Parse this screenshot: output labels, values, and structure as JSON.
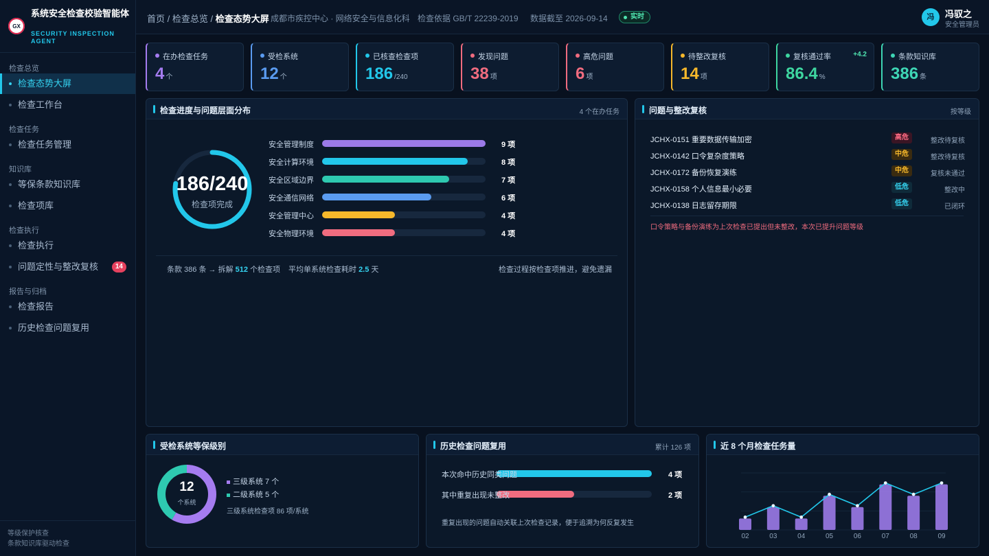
{
  "brand": {
    "logo_text": "GX",
    "title": "系统安全检查校验智能体",
    "subtitle": "SECURITY INSPECTION AGENT"
  },
  "sidebar": {
    "groups": [
      {
        "label": "检查总览",
        "items": [
          {
            "label": "检查态势大屏",
            "active": true
          },
          {
            "label": "检查工作台"
          }
        ]
      },
      {
        "label": "检查任务",
        "items": [
          {
            "label": "检查任务管理"
          }
        ]
      },
      {
        "label": "知识库",
        "items": [
          {
            "label": "等保条款知识库"
          },
          {
            "label": "检查项库"
          }
        ]
      },
      {
        "label": "检查执行",
        "items": [
          {
            "label": "检查执行"
          },
          {
            "label": "问题定性与整改复核",
            "badge": "14"
          }
        ]
      },
      {
        "label": "报告与归档",
        "items": [
          {
            "label": "检查报告"
          },
          {
            "label": "历史检查问题复用"
          }
        ]
      }
    ],
    "footer": [
      "等级保护核查",
      "条款知识库驱动检查"
    ]
  },
  "header": {
    "breadcrumb_home": "首页",
    "breadcrumb_mid": "检查总览",
    "breadcrumb_current": "检查态势大屏",
    "org": "成都市疾控中心 · 网络安全与信息化科",
    "basis": "检查依据 GB/T 22239-2019",
    "data_date": "数据截至 2026-09-14",
    "live": "实时",
    "user_initial": "冯",
    "user_name": "冯驭之",
    "user_role": "安全管理员"
  },
  "kpis": [
    {
      "label": "在办检查任务",
      "value": "4",
      "unit": "个",
      "color": "#a57cf0"
    },
    {
      "label": "受检系统",
      "value": "12",
      "unit": "个",
      "color": "#5a9bf0"
    },
    {
      "label": "已核查检查项",
      "value": "186",
      "unit": "/240",
      "color": "#22c7ea"
    },
    {
      "label": "发现问题",
      "value": "38",
      "unit": "项",
      "color": "#f06c7f"
    },
    {
      "label": "高危问题",
      "value": "6",
      "unit": "项",
      "color": "#f06c7f"
    },
    {
      "label": "待整改复核",
      "value": "14",
      "unit": "项",
      "color": "#f6b82b"
    },
    {
      "label": "复核通过率",
      "value": "86.4",
      "unit": "%",
      "color": "#3ed6a0",
      "delta": "+4.2"
    },
    {
      "label": "条款知识库",
      "value": "386",
      "unit": "条",
      "color": "#3ed6b5"
    }
  ],
  "progress_panel": {
    "title": "检查进度与问题层面分布",
    "extra": "4 个在办任务",
    "ring_value": "186/240",
    "ring_label": "检查项完成",
    "ring_done": 186,
    "ring_total": 240,
    "layers": [
      {
        "name": "安全管理制度",
        "value": 9,
        "label": "9 项",
        "color": "#9b7ae8"
      },
      {
        "name": "安全计算环境",
        "value": 8,
        "label": "8 项",
        "color": "#22c7ea"
      },
      {
        "name": "安全区域边界",
        "value": 7,
        "label": "7 项",
        "color": "#2ec9b0"
      },
      {
        "name": "安全通信网络",
        "value": 6,
        "label": "6 项",
        "color": "#5a9bf0"
      },
      {
        "name": "安全管理中心",
        "value": 4,
        "label": "4 项",
        "color": "#f6b82b"
      },
      {
        "name": "安全物理环境",
        "value": 4,
        "label": "4 项",
        "color": "#f06c7f"
      }
    ],
    "layer_max": 9,
    "foot_a1": "条款 386 条 → 拆解",
    "foot_a2": "512",
    "foot_a3": "个检查项",
    "foot_b1": "平均单系统检查耗时",
    "foot_b2": "2.5",
    "foot_b3": "天",
    "foot_c": "检查过程按检查项推进，避免遗漏"
  },
  "issues_panel": {
    "title": "问题与整改复核",
    "extra": "按等级",
    "rows": [
      {
        "name": "JCHX-0151 重要数据传输加密",
        "level": "高危",
        "status": "整改待复核"
      },
      {
        "name": "JCHX-0142 口令复杂度策略",
        "level": "中危",
        "status": "整改待复核"
      },
      {
        "name": "JCHX-0172 备份恢复演练",
        "level": "中危",
        "status": "复核未通过"
      },
      {
        "name": "JCHX-0158 个人信息最小必要",
        "level": "低危",
        "status": "整改中"
      },
      {
        "name": "JCHX-0138 日志留存期限",
        "level": "低危",
        "status": "已闭环"
      }
    ],
    "note": "口令策略与备份演练为上次检查已提出但未整改，本次已提升问题等级",
    "level_colors": {
      "高危": {
        "bg": "#3a1524",
        "fg": "#ff6b84"
      },
      "中危": {
        "bg": "#3a2b10",
        "fg": "#f6b82b"
      },
      "低危": {
        "bg": "#0f2b3a",
        "fg": "#35d3f1"
      }
    },
    "status_closed_color": "#8ea2b8"
  },
  "level_panel": {
    "title": "受检系统等保级别",
    "total": "12",
    "total_label": "个系统",
    "legend": [
      {
        "label": "三级系统 7 个",
        "value": 7,
        "color": "#a57cf0"
      },
      {
        "label": "二级系统 5 个",
        "value": 5,
        "color": "#2ec9b0"
      }
    ],
    "note": "三级系统检查项 86 项/系统"
  },
  "reuse_panel": {
    "title": "历史检查问题复用",
    "extra": "累计 126 项",
    "rows": [
      {
        "name": "本次命中历史同类问题",
        "value": 4,
        "label": "4 项",
        "fraction": 1.0,
        "color": "#22c7ea"
      },
      {
        "name": "其中重复出现未整改",
        "value": 2,
        "label": "2 项",
        "fraction": 0.5,
        "color": "#f06c7f"
      }
    ],
    "note": "重复出现的问题自动关联上次检查记录，便于追溯为何反复发生"
  },
  "monthly_panel": {
    "title": "近 8 个月检查任务量"
  },
  "chart_data": {
    "type": "bar",
    "title": "近 8 个月检查任务量",
    "categories": [
      "02",
      "03",
      "04",
      "05",
      "06",
      "07",
      "08",
      "09"
    ],
    "values": [
      1,
      2,
      1,
      3,
      2,
      4,
      3,
      4
    ],
    "line_overlay": true,
    "grid": true,
    "ylim": [
      0,
      5
    ],
    "bar_color": "#9b7ae8",
    "line_color": "#22c7ea"
  }
}
